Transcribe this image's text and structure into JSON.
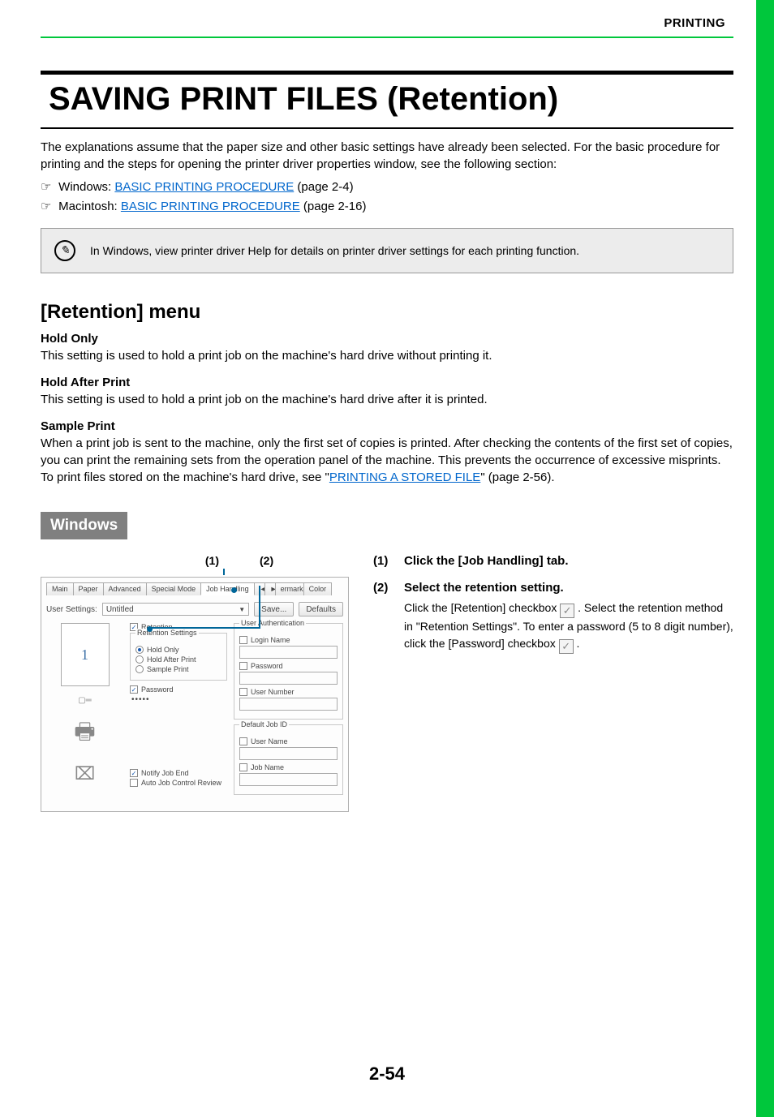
{
  "header_label": "PRINTING",
  "title": "SAVING PRINT FILES (Retention)",
  "intro": "The explanations assume that the paper size and other basic settings have already been selected. For the basic procedure for printing and the steps for opening the printer driver properties window, see the following section:",
  "refs": [
    {
      "prefix": "Windows: ",
      "link": "BASIC PRINTING PROCEDURE",
      "suffix": " (page 2-4)"
    },
    {
      "prefix": "Macintosh: ",
      "link": "BASIC PRINTING PROCEDURE",
      "suffix": " (page 2-16)"
    }
  ],
  "note_text": "In Windows, view printer driver Help for details on printer driver settings for each printing function.",
  "h2": "[Retention] menu",
  "subs": [
    {
      "title": "Hold Only",
      "body": "This setting is used to hold a print job on the machine's hard drive without printing it."
    },
    {
      "title": "Hold After Print",
      "body": "This setting is used to hold a print job on the machine's hard drive after it is printed."
    },
    {
      "title": "Sample Print",
      "body_pre": "When a print job is sent to the machine, only the first set of copies is printed. After checking the contents of the first set of copies, you can print the remaining sets from the operation panel of the machine. This prevents the occurrence of excessive misprints.",
      "body_post_pre": "To print files stored on the machine's hard drive, see \"",
      "body_post_link": "PRINTING A STORED FILE",
      "body_post_suf": "\" (page 2-56)."
    }
  ],
  "os_badge": "Windows",
  "callout_labels": [
    "(1)",
    "(2)"
  ],
  "screenshot": {
    "tabs": [
      "Main",
      "Paper",
      "Advanced",
      "Special Mode",
      "Job Handling",
      "Watermarks",
      "Color"
    ],
    "active_tab": "Job Handling",
    "user_settings_label": "User Settings:",
    "user_settings_value": "Untitled",
    "save_btn": "Save...",
    "defaults_btn": "Defaults",
    "preview_number": "1",
    "retention_chk": "Retention",
    "retention_legend": "Retention Settings",
    "opt_hold_only": "Hold Only",
    "opt_hold_after": "Hold After Print",
    "opt_sample": "Sample Print",
    "password_chk": "Password",
    "password_value": "•••••",
    "notify_chk": "Notify Job End",
    "auto_chk": "Auto Job Control Review",
    "ua_legend": "User Authentication",
    "login_chk": "Login Name",
    "pw_chk": "Password",
    "usernum_chk": "User Number",
    "default_jobid": "Default Job ID",
    "username_chk": "User Name",
    "jobname_chk": "Job Name"
  },
  "steps": [
    {
      "num": "(1)",
      "title": "Click the [Job Handling] tab."
    },
    {
      "num": "(2)",
      "title": "Select the retention setting.",
      "text_a": "Click the [Retention] checkbox ",
      "text_b": " . Select the retention method in \"Retention Settings\". To enter a password (5 to 8 digit number), click the [Password] checkbox ",
      "text_c": " ."
    }
  ],
  "page_number": "2-54"
}
